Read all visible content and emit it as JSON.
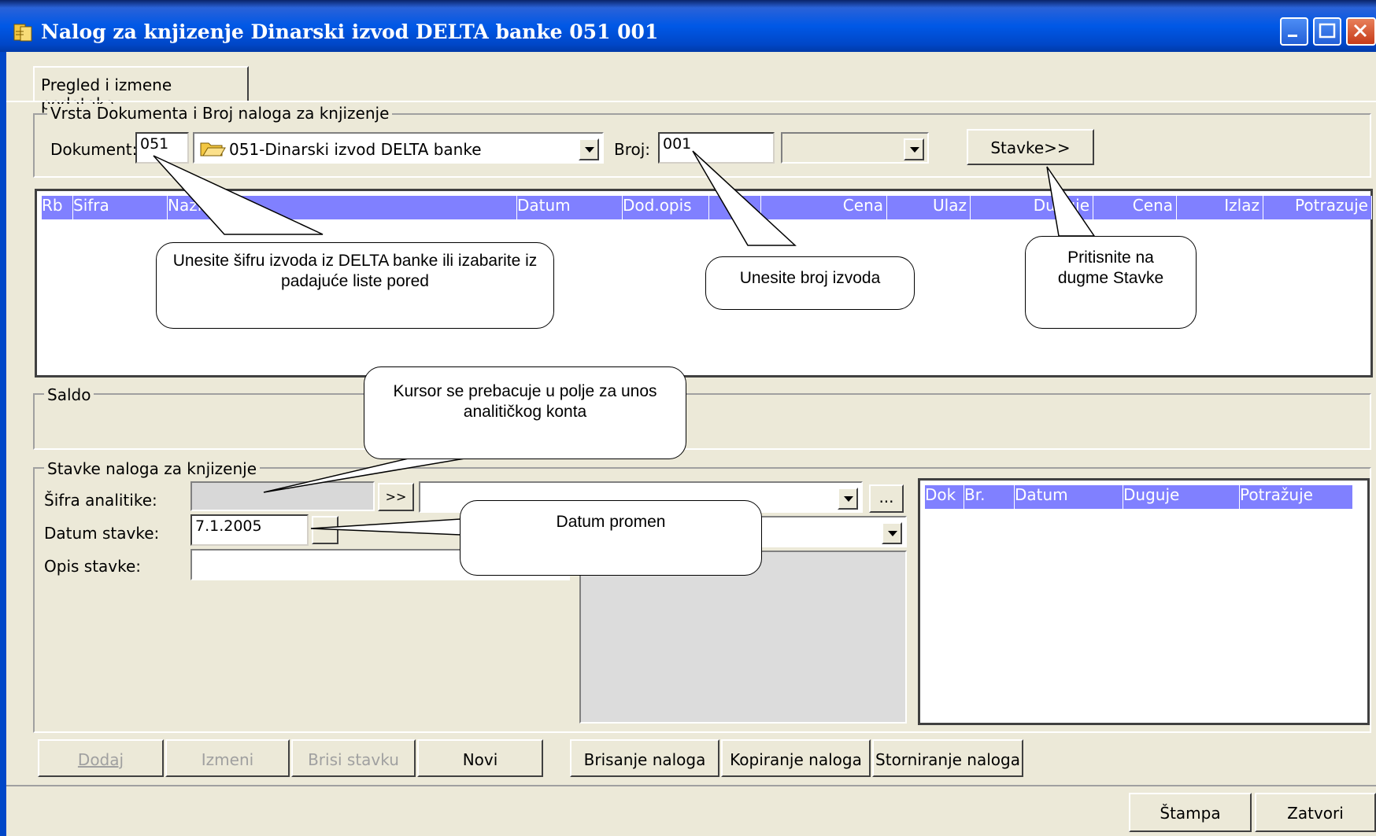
{
  "window": {
    "title": "Nalog za knjizenje Dinarski izvod DELTA banke 051 001",
    "accent": "#0047c8"
  },
  "tab": {
    "label": "Pregled i izmene podataka"
  },
  "doc_group": {
    "legend": "Vrsta Dokumenta i Broj naloga za knjizenje",
    "dokument_label": "Dokument:",
    "dokument_value": "051",
    "dokument_combo": "051-Dinarski izvod DELTA banke",
    "broj_label": "Broj:",
    "broj_value": "001",
    "broj_combo": "",
    "stavke_button": "Stavke>>"
  },
  "main_grid": {
    "columns": [
      "Rb",
      "Sifra",
      "Naziv",
      "Datum",
      "Dod.opis",
      "",
      "Cena",
      "Ulaz",
      "Duguje",
      "Cena",
      "Izlaz",
      "Potrazuje"
    ],
    "header_color": "#8080ff"
  },
  "saldo": {
    "legend": "Saldo"
  },
  "stavke_group": {
    "legend": "Stavke naloga za knjizenje",
    "sifra_label": "Šifra analitike:",
    "sifra_value": "",
    "browse_button": ">>",
    "ellipsis_button": "...",
    "datum_label": "Datum stavke:",
    "datum_value": "7.1.2005",
    "opis_label": "Opis stavke:",
    "opis_value": ""
  },
  "side_grid": {
    "columns": [
      "Dok",
      "Br.",
      "Datum",
      "Duguje",
      "Potražuje"
    ]
  },
  "action_buttons": {
    "dodaj": "Dodaj",
    "izmeni": "Izmeni",
    "brisi_stavku": "Brisi stavku",
    "novi": "Novi",
    "brisanje": "Brisanje naloga",
    "kopiranje": "Kopiranje naloga",
    "storniranje": "Storniranje naloga"
  },
  "bottom_buttons": {
    "stampa": "Štampa",
    "zatvori": "Zatvori"
  },
  "callouts": {
    "sifra": "Unesite šifru izvoda iz DELTA banke ili izabarite iz padajuće liste pored",
    "broj": "Unesite broj izvoda",
    "stavke": "Pritisnite na dugme Stavke",
    "kursor": "Kursor se prebacuje u polje za unos analitičkog konta",
    "datum": "Datum promen"
  }
}
